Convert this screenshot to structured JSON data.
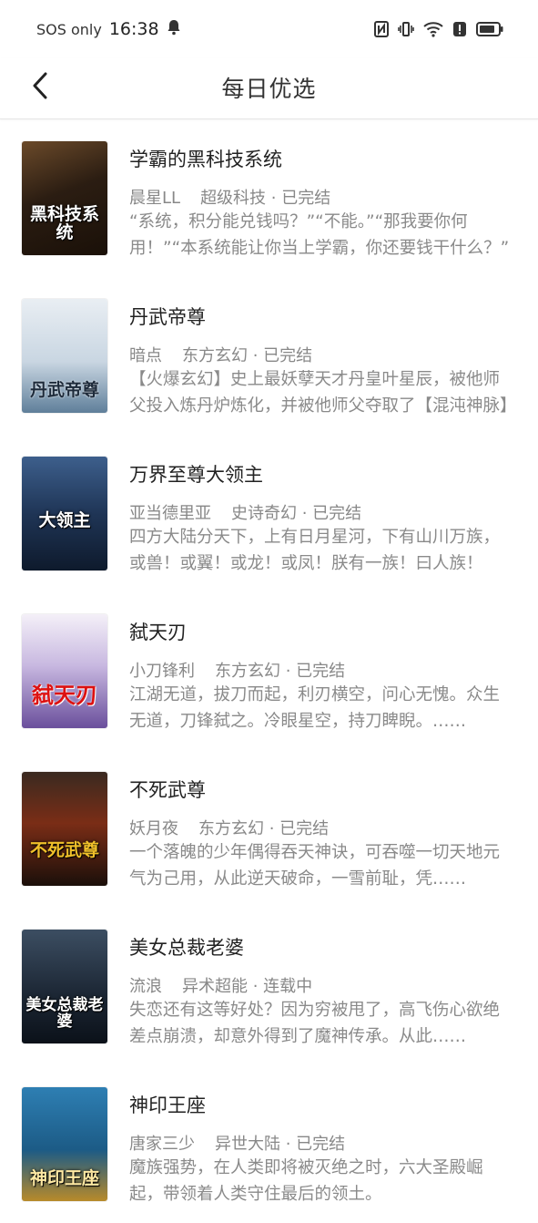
{
  "status": {
    "carrier": "SOS only",
    "time": "16:38"
  },
  "header": {
    "title": "每日优选"
  },
  "books": [
    {
      "title": "学霸的黑科技系统",
      "author": "晨星LL",
      "category": "超级科技",
      "state": "已完结",
      "desc": "“系统，积分能兑钱吗？”“不能。”“那我要你何用！”“本系统能让你当上学霸，你还要钱干什么？”",
      "cover_text": "黑科技系统",
      "cover_bg": "linear-gradient(160deg,#6b4a2a 0%,#2b1d12 45%,#1a1008 100%)"
    },
    {
      "title": "丹武帝尊",
      "author": "暗点",
      "category": "东方玄幻",
      "state": "已完结",
      "desc": "【火爆玄幻】史上最妖孽天才丹皇叶星辰，被他师父投入炼丹炉炼化，并被他师父夺取了【混沌神脉】",
      "cover_text": "丹武帝尊",
      "cover_bg": "linear-gradient(180deg,#e9eef3 0%,#c9d6e2 55%,#5f7f9a 100%)"
    },
    {
      "title": "万界至尊大领主",
      "author": "亚当德里亚",
      "category": "史诗奇幻",
      "state": "已完结",
      "desc": "四方大陆分天下，上有日月星河，下有山川万族，或兽！或翼！或龙！或凤！朕有一族！曰人族！",
      "cover_text": "大领主",
      "cover_bg": "linear-gradient(180deg,#3d5f8c 0%,#1f3556 50%,#0e1a2c 100%)"
    },
    {
      "title": "弑天刃",
      "author": "小刀锋利",
      "category": "东方玄幻",
      "state": "已完结",
      "desc": "江湖无道，拔刀而起，利刃横空，问心无愧。众生无道，刀锋弑之。冷眼星空，持刀睥睨。……",
      "cover_text": "弑天刃",
      "cover_bg": "linear-gradient(180deg,#f4f0f8 0%,#c8b8e0 45%,#6a4f9c 100%)"
    },
    {
      "title": "不死武尊",
      "author": "妖月夜",
      "category": "东方玄幻",
      "state": "已完结",
      "desc": "一个落魄的少年偶得吞天神诀，可吞噬一切天地元气为己用，从此逆天破命，一雪前耻，凭……",
      "cover_text": "不死武尊",
      "cover_bg": "linear-gradient(180deg,#3a2a20 0%,#7a2d16 45%,#1b0f0a 100%)"
    },
    {
      "title": "美女总裁老婆",
      "author": "流浪",
      "category": "异术超能",
      "state": "连载中",
      "desc": "失恋还有这等好处？因为穷被甩了，高飞伤心欲绝差点崩溃，却意外得到了魔神传承。从此……",
      "cover_text": "美女总裁老婆",
      "cover_bg": "linear-gradient(180deg,#3c4e62 0%,#1d2836 55%,#0b1119 100%)"
    },
    {
      "title": "神印王座",
      "author": "唐家三少",
      "category": "异世大陆",
      "state": "已完结",
      "desc": "魔族强势，在人类即将被灭绝之时，六大圣殿崛起，带领着人类守住最后的领土。",
      "cover_text": "神印王座",
      "cover_bg": "linear-gradient(180deg,#2e7fb3 0%,#1c5b86 55%,#b88a2a 100%)"
    }
  ]
}
